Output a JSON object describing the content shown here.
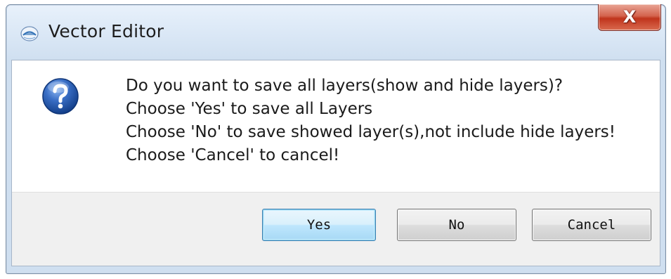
{
  "window": {
    "title": "Vector Editor",
    "close_glyph": "X",
    "app_icon": "app-logo-icon"
  },
  "dialog": {
    "icon": "question-icon",
    "lines": [
      "Do you want to save all layers(show and hide layers)?",
      "Choose 'Yes' to save all Layers",
      "Choose 'No' to save showed layer(s),not include hide layers!",
      "Choose 'Cancel' to cancel!"
    ]
  },
  "buttons": {
    "yes": "Yes",
    "no": "No",
    "cancel": "Cancel"
  },
  "colors": {
    "title_bar": "#dbe8f6",
    "close_button": "#c0341c",
    "default_button_border": "#3c7fb1",
    "question_icon": "#1f4f9e"
  }
}
